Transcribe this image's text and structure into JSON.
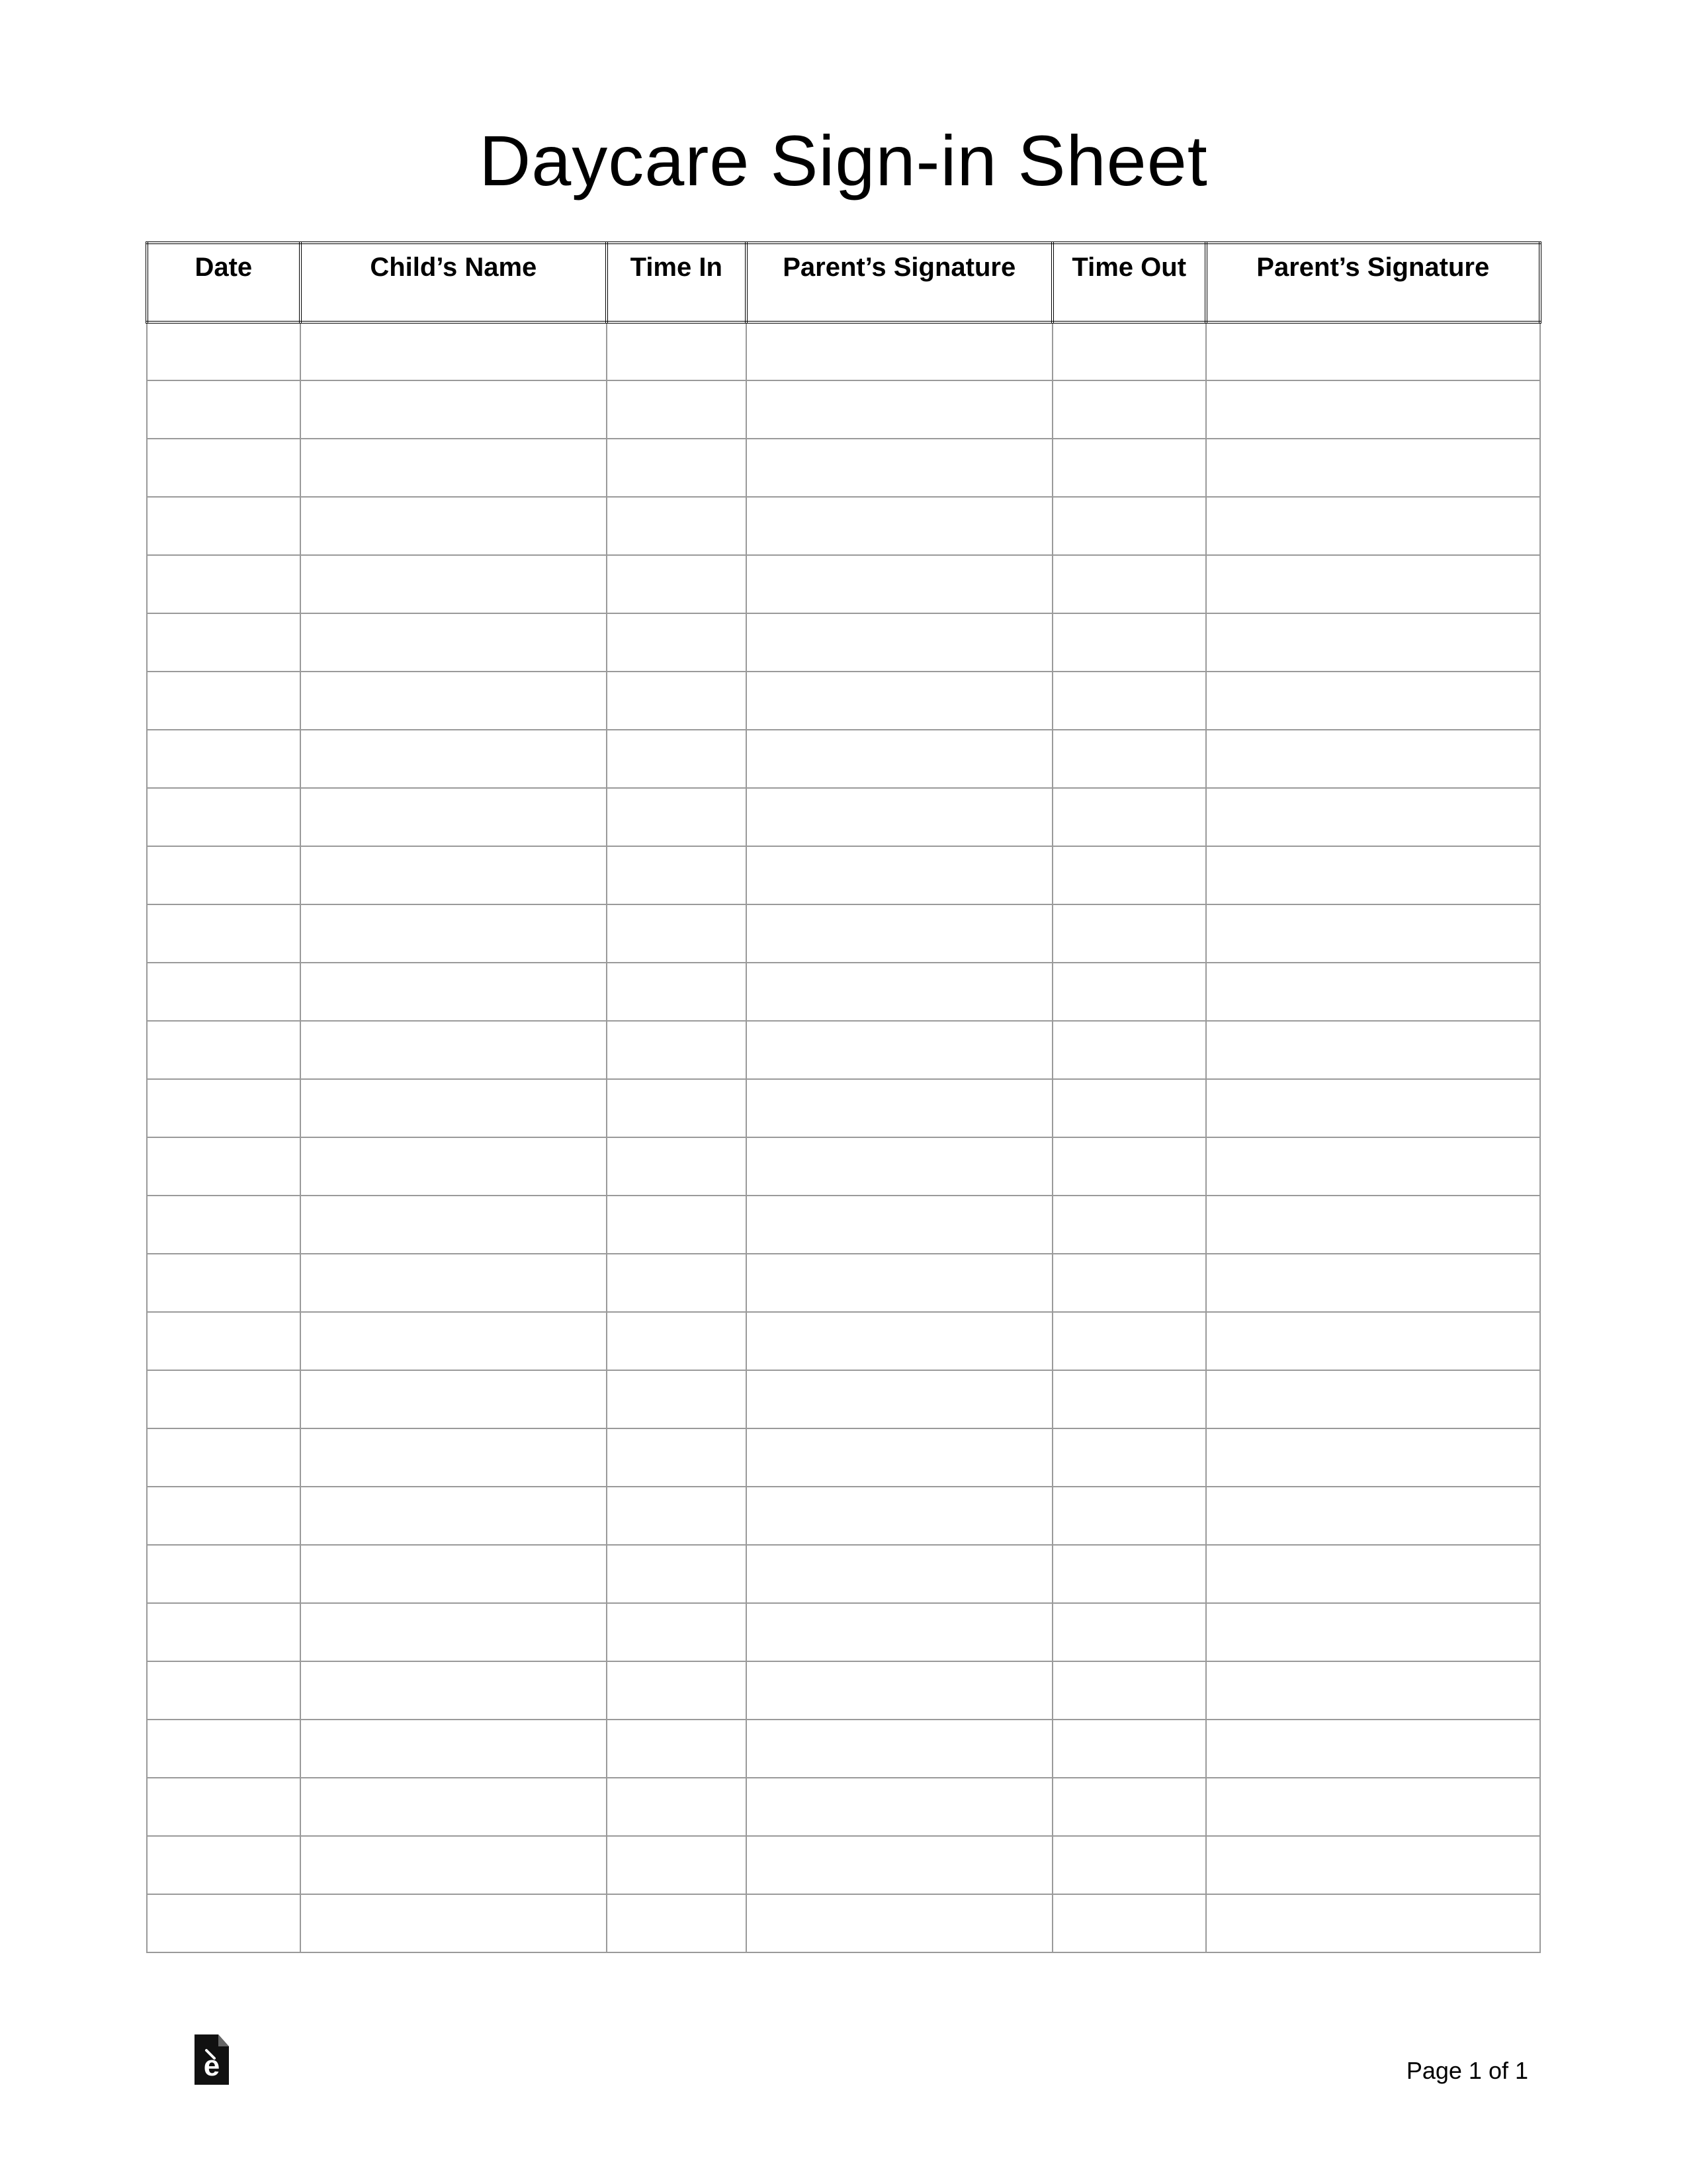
{
  "title": "Daycare Sign-in Sheet",
  "columns": [
    "Date",
    "Child’s Name",
    "Time In",
    "Parent’s Signature",
    "Time Out",
    "Parent’s Signature"
  ],
  "row_count": 28,
  "footer": {
    "page_label": "Page 1 of 1",
    "logo_letter": "e"
  }
}
